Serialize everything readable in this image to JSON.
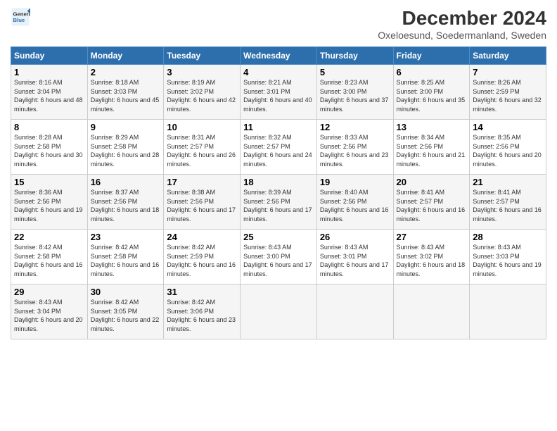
{
  "logo": {
    "line1": "General",
    "line2": "Blue"
  },
  "title": "December 2024",
  "subtitle": "Oxeloesund, Soedermanland, Sweden",
  "days_of_week": [
    "Sunday",
    "Monday",
    "Tuesday",
    "Wednesday",
    "Thursday",
    "Friday",
    "Saturday"
  ],
  "weeks": [
    [
      {
        "day": 1,
        "sunrise": "8:16 AM",
        "sunset": "3:04 PM",
        "daylight": "6 hours and 48 minutes."
      },
      {
        "day": 2,
        "sunrise": "8:18 AM",
        "sunset": "3:03 PM",
        "daylight": "6 hours and 45 minutes."
      },
      {
        "day": 3,
        "sunrise": "8:19 AM",
        "sunset": "3:02 PM",
        "daylight": "6 hours and 42 minutes."
      },
      {
        "day": 4,
        "sunrise": "8:21 AM",
        "sunset": "3:01 PM",
        "daylight": "6 hours and 40 minutes."
      },
      {
        "day": 5,
        "sunrise": "8:23 AM",
        "sunset": "3:00 PM",
        "daylight": "6 hours and 37 minutes."
      },
      {
        "day": 6,
        "sunrise": "8:25 AM",
        "sunset": "3:00 PM",
        "daylight": "6 hours and 35 minutes."
      },
      {
        "day": 7,
        "sunrise": "8:26 AM",
        "sunset": "2:59 PM",
        "daylight": "6 hours and 32 minutes."
      }
    ],
    [
      {
        "day": 8,
        "sunrise": "8:28 AM",
        "sunset": "2:58 PM",
        "daylight": "6 hours and 30 minutes."
      },
      {
        "day": 9,
        "sunrise": "8:29 AM",
        "sunset": "2:58 PM",
        "daylight": "6 hours and 28 minutes."
      },
      {
        "day": 10,
        "sunrise": "8:31 AM",
        "sunset": "2:57 PM",
        "daylight": "6 hours and 26 minutes."
      },
      {
        "day": 11,
        "sunrise": "8:32 AM",
        "sunset": "2:57 PM",
        "daylight": "6 hours and 24 minutes."
      },
      {
        "day": 12,
        "sunrise": "8:33 AM",
        "sunset": "2:56 PM",
        "daylight": "6 hours and 23 minutes."
      },
      {
        "day": 13,
        "sunrise": "8:34 AM",
        "sunset": "2:56 PM",
        "daylight": "6 hours and 21 minutes."
      },
      {
        "day": 14,
        "sunrise": "8:35 AM",
        "sunset": "2:56 PM",
        "daylight": "6 hours and 20 minutes."
      }
    ],
    [
      {
        "day": 15,
        "sunrise": "8:36 AM",
        "sunset": "2:56 PM",
        "daylight": "6 hours and 19 minutes."
      },
      {
        "day": 16,
        "sunrise": "8:37 AM",
        "sunset": "2:56 PM",
        "daylight": "6 hours and 18 minutes."
      },
      {
        "day": 17,
        "sunrise": "8:38 AM",
        "sunset": "2:56 PM",
        "daylight": "6 hours and 17 minutes."
      },
      {
        "day": 18,
        "sunrise": "8:39 AM",
        "sunset": "2:56 PM",
        "daylight": "6 hours and 17 minutes."
      },
      {
        "day": 19,
        "sunrise": "8:40 AM",
        "sunset": "2:56 PM",
        "daylight": "6 hours and 16 minutes."
      },
      {
        "day": 20,
        "sunrise": "8:41 AM",
        "sunset": "2:57 PM",
        "daylight": "6 hours and 16 minutes."
      },
      {
        "day": 21,
        "sunrise": "8:41 AM",
        "sunset": "2:57 PM",
        "daylight": "6 hours and 16 minutes."
      }
    ],
    [
      {
        "day": 22,
        "sunrise": "8:42 AM",
        "sunset": "2:58 PM",
        "daylight": "6 hours and 16 minutes."
      },
      {
        "day": 23,
        "sunrise": "8:42 AM",
        "sunset": "2:58 PM",
        "daylight": "6 hours and 16 minutes."
      },
      {
        "day": 24,
        "sunrise": "8:42 AM",
        "sunset": "2:59 PM",
        "daylight": "6 hours and 16 minutes."
      },
      {
        "day": 25,
        "sunrise": "8:43 AM",
        "sunset": "3:00 PM",
        "daylight": "6 hours and 17 minutes."
      },
      {
        "day": 26,
        "sunrise": "8:43 AM",
        "sunset": "3:01 PM",
        "daylight": "6 hours and 17 minutes."
      },
      {
        "day": 27,
        "sunrise": "8:43 AM",
        "sunset": "3:02 PM",
        "daylight": "6 hours and 18 minutes."
      },
      {
        "day": 28,
        "sunrise": "8:43 AM",
        "sunset": "3:03 PM",
        "daylight": "6 hours and 19 minutes."
      }
    ],
    [
      {
        "day": 29,
        "sunrise": "8:43 AM",
        "sunset": "3:04 PM",
        "daylight": "6 hours and 20 minutes."
      },
      {
        "day": 30,
        "sunrise": "8:42 AM",
        "sunset": "3:05 PM",
        "daylight": "6 hours and 22 minutes."
      },
      {
        "day": 31,
        "sunrise": "8:42 AM",
        "sunset": "3:06 PM",
        "daylight": "6 hours and 23 minutes."
      },
      null,
      null,
      null,
      null
    ]
  ]
}
